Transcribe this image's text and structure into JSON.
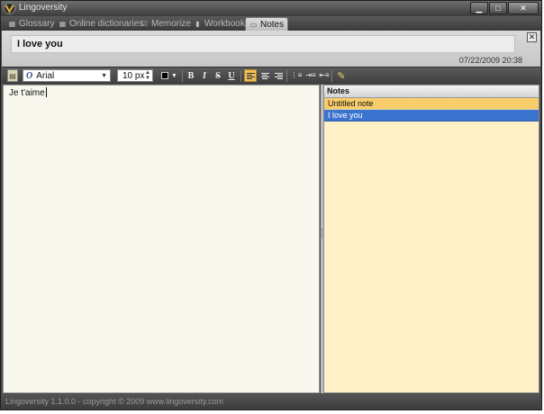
{
  "window": {
    "title": "Lingoversity"
  },
  "tabs": [
    {
      "label": "Glossary",
      "icon": "grid-icon"
    },
    {
      "label": "Online dictionaries",
      "icon": "grid-icon"
    },
    {
      "label": "Memorize",
      "icon": "check-icon"
    },
    {
      "label": "Workbook",
      "icon": "workbook-icon"
    },
    {
      "label": "Notes",
      "icon": "note-icon",
      "active": true
    }
  ],
  "header": {
    "title": "I love you",
    "timestamp": "07/22/2009 20:38"
  },
  "toolbar": {
    "font_family": "Arial",
    "font_size": "10 px",
    "bold_label": "B",
    "italic_label": "I",
    "strike_label": "S",
    "underline_label": "U",
    "text_color": "#000000",
    "alignment": "left"
  },
  "editor": {
    "content": "Je t'aime"
  },
  "notes": {
    "header": "Notes",
    "items": [
      {
        "title": "Untitled note",
        "state": "highlighted"
      },
      {
        "title": "I love you",
        "state": "selected"
      }
    ]
  },
  "status": {
    "text": "Lingoversity 1.1.0.0   -   copyright © 2009 www.lingoversity.com"
  },
  "colors": {
    "selection": "#3b74cf",
    "notes_background": "#fff0c8",
    "highlight": "#f8cd6c"
  }
}
